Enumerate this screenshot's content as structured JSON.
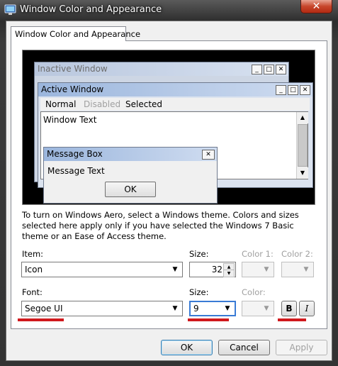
{
  "window": {
    "title": "Window Color and Appearance",
    "close_glyph": "✕"
  },
  "tab": {
    "label": "Window Color and Appearance"
  },
  "preview": {
    "inactive_title": "Inactive Window",
    "active_title": "Active Window",
    "menu": {
      "normal": "Normal",
      "disabled": "Disabled",
      "selected": "Selected"
    },
    "window_text": "Window Text",
    "message_box_title": "Message Box",
    "message_text": "Message Text",
    "ok_label": "OK",
    "buttons": {
      "minimize": "_",
      "maximize": "□",
      "close": "✕"
    }
  },
  "description": "To turn on Windows Aero, select a Windows theme.  Colors and sizes selected here apply only if you have selected the Windows 7 Basic theme or an Ease of Access theme.",
  "item_row": {
    "item_label": "Item:",
    "item_value": "Icon",
    "size_label": "Size:",
    "size_value": "32",
    "color1_label": "Color 1:",
    "color2_label": "Color 2:"
  },
  "font_row": {
    "font_label": "Font:",
    "font_value": "Segoe UI",
    "size_label": "Size:",
    "size_value": "9",
    "color_label": "Color:",
    "bold_label": "B",
    "italic_label": "I"
  },
  "footer": {
    "ok": "OK",
    "cancel": "Cancel",
    "apply": "Apply"
  },
  "colors": {
    "highlight_underline": "#d0191d",
    "active_title": "#9bb6dd"
  },
  "icons": {
    "app": "display-properties-icon"
  }
}
